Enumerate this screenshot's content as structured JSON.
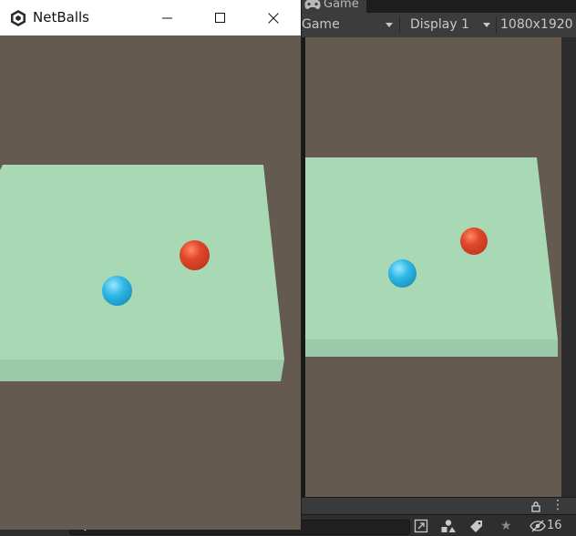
{
  "window": {
    "title": "NetBalls",
    "icons": {
      "app": "unity-logo-icon",
      "minimize": "minimize-icon",
      "maximize": "maximize-icon",
      "close": "close-icon"
    }
  },
  "scene": {
    "floor_color": "#a8d8b4",
    "floor_side_color": "#9ccaa8",
    "background_color": "#645a4f",
    "balls": [
      {
        "name": "red ball",
        "color": "#d9431f"
      },
      {
        "name": "blue ball",
        "color": "#2eb4e0"
      }
    ]
  },
  "editor": {
    "game_tab": {
      "label": "Game",
      "icon": "gamepad-icon"
    },
    "toolbar": {
      "view_label": "Game",
      "display_label": "Display 1",
      "resolution_label": "1080x1920"
    },
    "status": {
      "visibility_count": "16",
      "icons": [
        "lock-icon",
        "more-icon",
        "search-icon",
        "scene-gizmo-icon",
        "shapes-icon",
        "tag-icon",
        "star-icon",
        "eye-slash-icon"
      ]
    }
  }
}
